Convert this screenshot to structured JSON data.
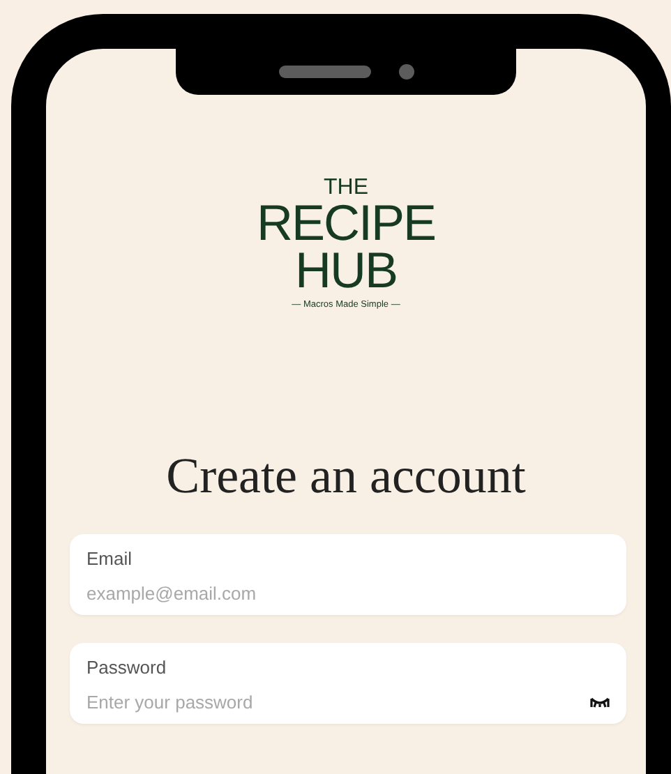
{
  "logo": {
    "lines": [
      "THE",
      "RECIPE",
      "HUB"
    ],
    "tagline": "— Macros Made Simple —"
  },
  "title": "Create an account",
  "fields": [
    {
      "kind": "email",
      "label": "Email",
      "placeholder": "example@email.com"
    },
    {
      "kind": "password",
      "label": "Password",
      "placeholder": "Enter your password"
    }
  ]
}
